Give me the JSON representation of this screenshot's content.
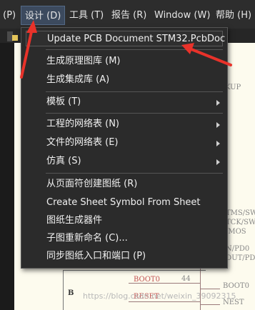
{
  "menubar": {
    "items": [
      {
        "label": " (P)"
      },
      {
        "label": "设计 (D)"
      },
      {
        "label": "工具 (T)"
      },
      {
        "label": "报告 (R)"
      },
      {
        "label": "Window (W)"
      },
      {
        "label": "帮助 (H)"
      }
    ]
  },
  "dropdown": {
    "items": [
      {
        "label": "Update PCB Document STM32.PcbDoc",
        "submenu": false
      },
      {
        "label": "生成原理图库 (M)",
        "submenu": false
      },
      {
        "label": "生成集成库 (A)",
        "submenu": false
      },
      {
        "label": "模板 (T)",
        "submenu": true
      },
      {
        "label": "工程的网络表 (N)",
        "submenu": true
      },
      {
        "label": "文件的网络表 (E)",
        "submenu": true
      },
      {
        "label": "仿真 (S)",
        "submenu": true
      },
      {
        "label": "从页面符创建图纸 (R)",
        "submenu": false
      },
      {
        "label": "Create Sheet Symbol From Sheet",
        "submenu": false
      },
      {
        "label": "图纸生成器件",
        "submenu": false
      },
      {
        "label": "子图重新命名 (C)...",
        "submenu": false
      },
      {
        "label": "同步图纸入口和端口 (P)",
        "submenu": false
      }
    ]
  },
  "schematic": {
    "labels": {
      "kup": "KUP",
      "tms": "TMS/SW",
      "tck": "TCK/SW",
      "mos": "/MOS",
      "pd0": "N/PD0",
      "out": "OUT/PD1",
      "boot0_left": "BOOT0",
      "pin44": "44",
      "boot0_right": "BOOT0",
      "reset": "RESET",
      "nest": "NEST",
      "b": "B",
      "watermark": "https://blog.csdn.net/weixin_39092315"
    }
  },
  "colors": {
    "annotation_red": "#e8322a",
    "menu_bg": "#2b2b2b",
    "schematic_bg": "#fdfbee"
  }
}
